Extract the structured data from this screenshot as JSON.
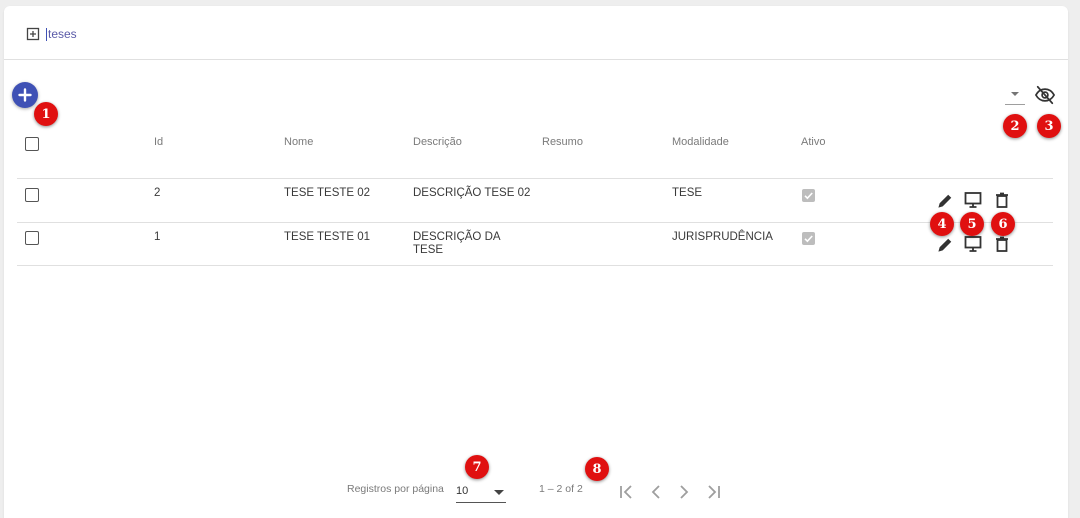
{
  "breadcrumb": {
    "label": "teses",
    "icon": "add-box-icon"
  },
  "toolbar": {
    "add_icon": "plus-icon",
    "column_select_icon": "dropdown-caret-icon",
    "visibility_icon": "eye-off-icon"
  },
  "table": {
    "columns": [
      "Id",
      "Nome",
      "Descrição",
      "Resumo",
      "Modalidade",
      "Ativo"
    ],
    "rows": [
      {
        "id": "2",
        "nome": "TESE TESTE 02",
        "descricao": "DESCRIÇÃO TESE 02",
        "descricao_line2": "",
        "resumo": "",
        "modalidade": "TESE",
        "ativo": true
      },
      {
        "id": "1",
        "nome": "TESE TESTE 01",
        "descricao": "DESCRIÇÃO DA",
        "descricao_line2": "TESE",
        "resumo": "",
        "modalidade": "JURISPRUDÊNCIA",
        "ativo": true
      }
    ],
    "row_actions": [
      "edit-icon",
      "monitor-icon",
      "delete-icon"
    ]
  },
  "paginator": {
    "page_size_label": "Registros por página",
    "page_size_value": "10",
    "range_label": "1 – 2 of 2",
    "nav_icons": [
      "first-page-icon",
      "previous-page-icon",
      "next-page-icon",
      "last-page-icon"
    ]
  },
  "annotations": [
    "1",
    "2",
    "3",
    "4",
    "5",
    "6",
    "7",
    "8"
  ],
  "colors": {
    "primary": "#3f51b5",
    "annotation_badge": "#e01010",
    "header_text": "#7a7a7a"
  }
}
